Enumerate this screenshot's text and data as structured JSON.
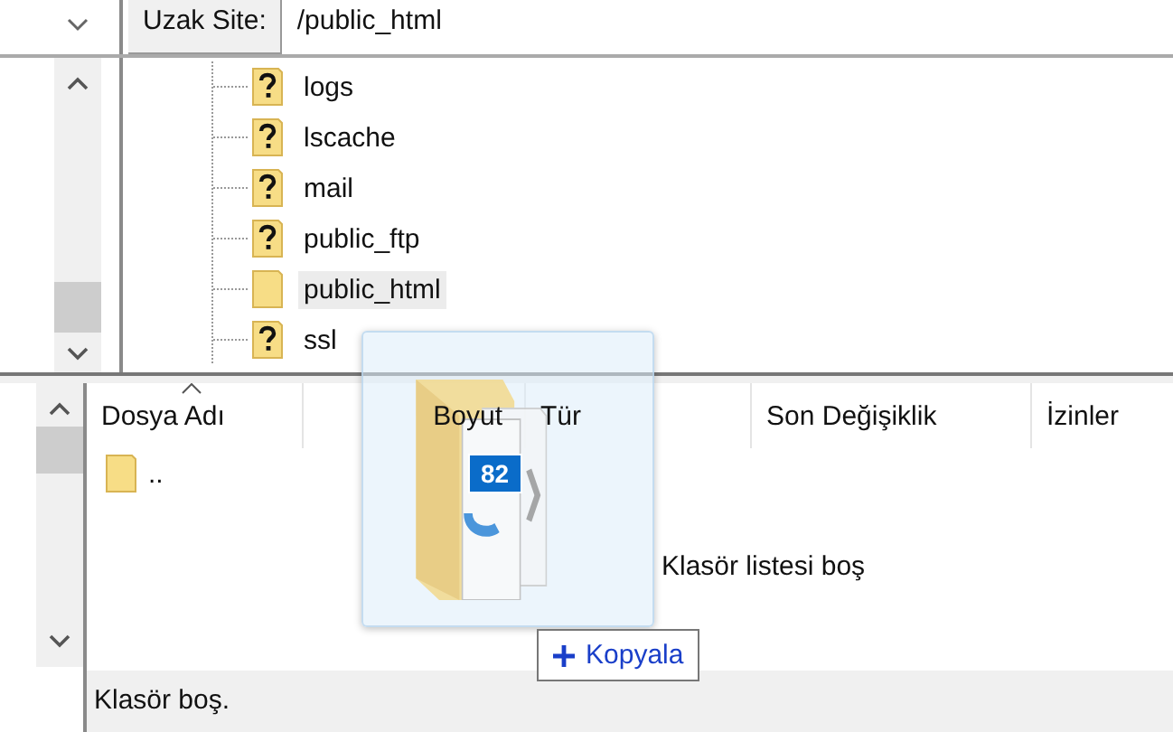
{
  "remote_site": {
    "label": "Uzak Site:",
    "path": "/public_html"
  },
  "tree": {
    "items": [
      {
        "name": "logs",
        "unknown": true,
        "selected": false
      },
      {
        "name": "lscache",
        "unknown": true,
        "selected": false
      },
      {
        "name": "mail",
        "unknown": true,
        "selected": false
      },
      {
        "name": "public_ftp",
        "unknown": true,
        "selected": false
      },
      {
        "name": "public_html",
        "unknown": false,
        "selected": true
      },
      {
        "name": "ssl",
        "unknown": true,
        "selected": false
      }
    ]
  },
  "file_list": {
    "columns": [
      {
        "label": "Dosya Adı",
        "sorted": true
      },
      {
        "label": "Boyut",
        "sorted": false
      },
      {
        "label": "Tür",
        "sorted": false
      },
      {
        "label": "Son Değişiklik",
        "sorted": false
      },
      {
        "label": "İzinler",
        "sorted": false
      }
    ],
    "rows": [
      {
        "name": ".."
      }
    ],
    "empty_message": "Klasör listesi boş"
  },
  "drag": {
    "count": "82",
    "action": "Kopyala"
  },
  "status_bar": "Klasör boş."
}
